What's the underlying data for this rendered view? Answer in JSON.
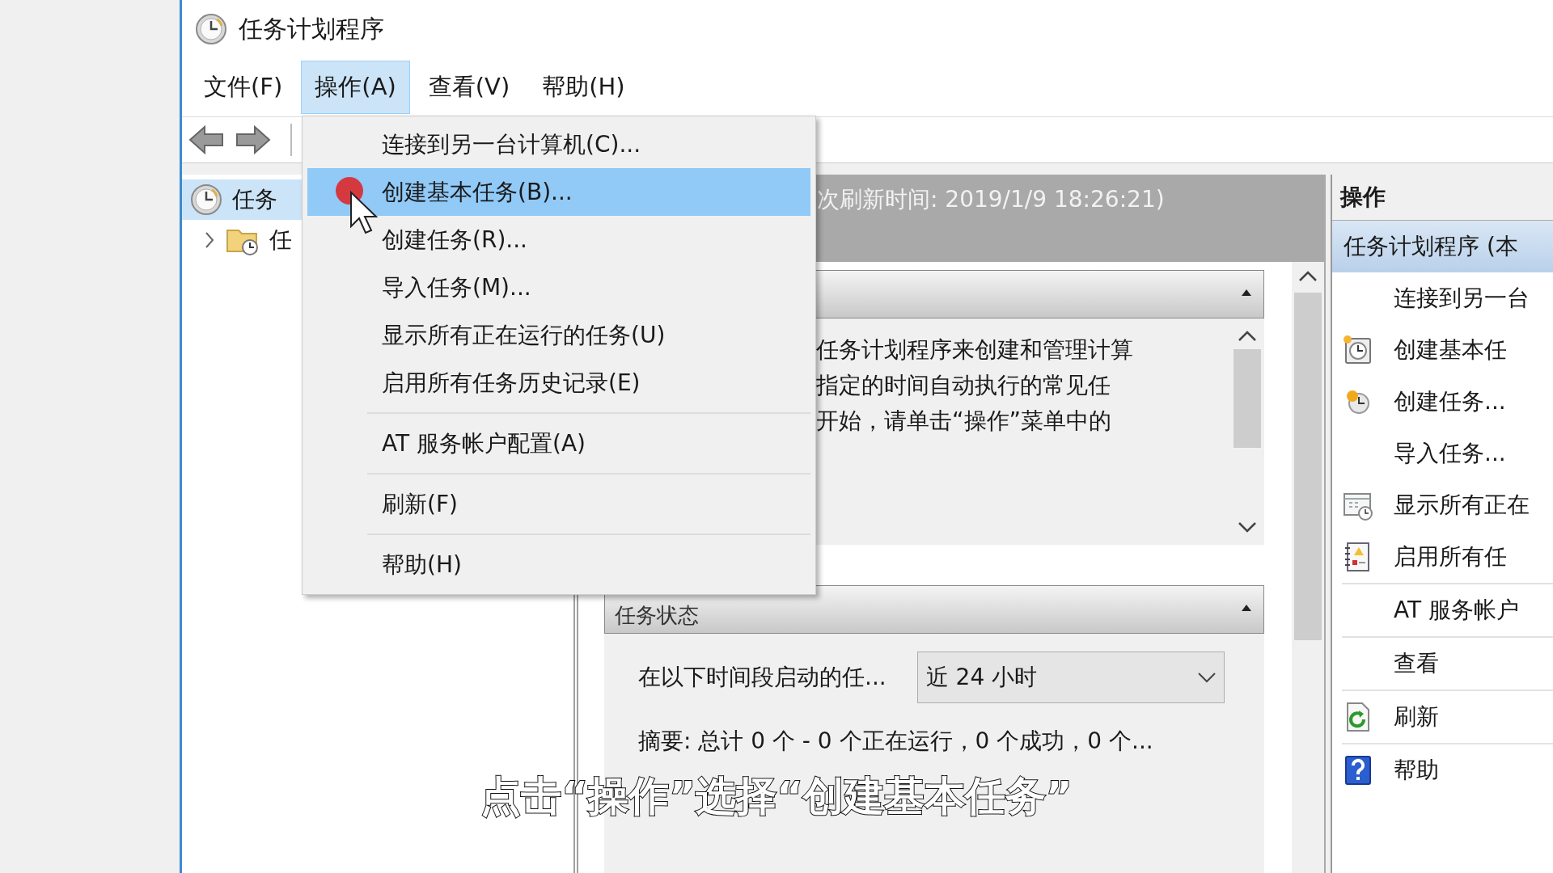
{
  "window": {
    "title": "任务计划程序"
  },
  "menu_bar": [
    {
      "label": "文件(F)",
      "selected": false
    },
    {
      "label": "操作(A)",
      "selected": true
    },
    {
      "label": "查看(V)",
      "selected": false
    },
    {
      "label": "帮助(H)",
      "selected": false
    }
  ],
  "open_menu": [
    {
      "kind": "item",
      "label": "连接到另一台计算机(C)...",
      "selected": false
    },
    {
      "kind": "item",
      "label": "创建基本任务(B)...",
      "selected": true
    },
    {
      "kind": "item",
      "label": "创建任务(R)...",
      "selected": false
    },
    {
      "kind": "item",
      "label": "导入任务(M)...",
      "selected": false
    },
    {
      "kind": "item",
      "label": "显示所有正在运行的任务(U)",
      "selected": false
    },
    {
      "kind": "item",
      "label": "启用所有任务历史记录(E)",
      "selected": false
    },
    {
      "kind": "separator"
    },
    {
      "kind": "item",
      "label": "AT 服务帐户配置(A)",
      "selected": false
    },
    {
      "kind": "separator"
    },
    {
      "kind": "item",
      "label": "刷新(F)",
      "selected": false
    },
    {
      "kind": "separator"
    },
    {
      "kind": "item",
      "label": "帮助(H)",
      "selected": false
    }
  ],
  "tree": [
    {
      "label": "任务",
      "selected": true,
      "children": [
        {
          "label": "任",
          "selected": false,
          "expanded": false
        }
      ]
    }
  ],
  "summary": {
    "refresh_info": "次刷新时间: 2019/1/9 18:26:21)",
    "overview": {
      "expanded": true,
      "lines": [
        "任务计划程序来创建和管理计算",
        "指定的时间自动执行的常见任",
        "开始，请单击“操作”菜单中的"
      ]
    },
    "task_status": {
      "title": "任务状态",
      "expanded": true,
      "period_label": "在以下时间段启动的任...",
      "period": "近 24 小时",
      "summary": "摘要: 总计 0 个 - 0 个正在运行，0 个成功，0 个..."
    }
  },
  "actions_pane": {
    "title": "操作",
    "items": [
      {
        "kind": "group",
        "label": "任务计划程序 (本"
      },
      {
        "kind": "action",
        "label": "连接到另一台"
      },
      {
        "kind": "action",
        "label": "创建基本任"
      },
      {
        "kind": "action",
        "label": "创建任务..."
      },
      {
        "kind": "action",
        "label": "导入任务..."
      },
      {
        "kind": "action",
        "label": "显示所有正在"
      },
      {
        "kind": "action",
        "label": "启用所有任"
      },
      {
        "kind": "separator"
      },
      {
        "kind": "action",
        "label": "AT 服务帐户"
      },
      {
        "kind": "separator"
      },
      {
        "kind": "action",
        "label": "查看"
      },
      {
        "kind": "separator"
      },
      {
        "kind": "action",
        "label": "刷新"
      },
      {
        "kind": "separator"
      },
      {
        "kind": "action",
        "label": "帮助"
      }
    ]
  },
  "subtitle": "点击“操作”选择“创建基本任务”"
}
